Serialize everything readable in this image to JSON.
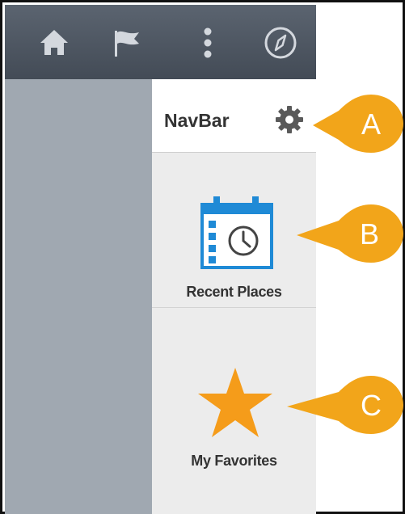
{
  "navbar": {
    "title": "NavBar",
    "items": [
      {
        "label": "Recent Places",
        "icon": "calendar-clock-icon"
      },
      {
        "label": "My Favorites",
        "icon": "star-icon"
      }
    ]
  },
  "topbar": {
    "icons": [
      "home-icon",
      "flag-icon",
      "vertical-dots-icon",
      "compass-icon"
    ]
  },
  "callouts": [
    {
      "letter": "A"
    },
    {
      "letter": "B"
    },
    {
      "letter": "C"
    }
  ],
  "colors": {
    "topbar": "#4e5661",
    "left_panel": "#a0a8b1",
    "navbar_panel": "#ececec",
    "callout": "#f2a51a",
    "calendar_blue": "#1f8ad6",
    "star": "#f59c1a"
  }
}
